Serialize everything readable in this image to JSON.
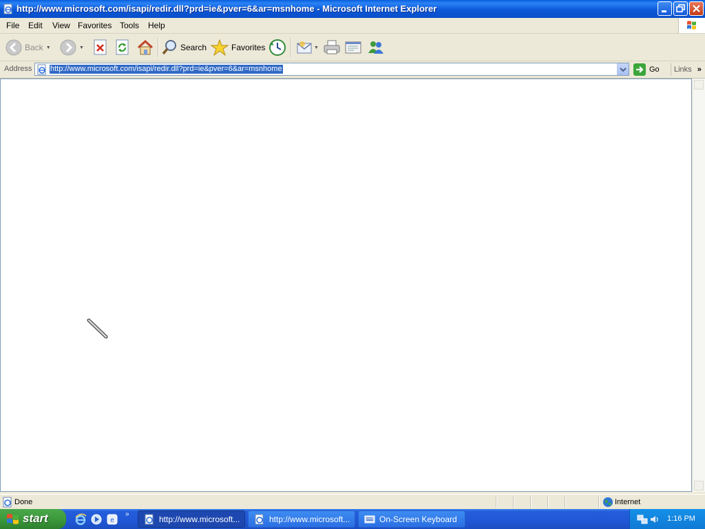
{
  "window": {
    "title": "http://www.microsoft.com/isapi/redir.dll?prd=ie&pver=6&ar=msnhome - Microsoft Internet Explorer"
  },
  "menu": {
    "items": [
      "File",
      "Edit",
      "View",
      "Favorites",
      "Tools",
      "Help"
    ]
  },
  "toolbar": {
    "back_label": "Back",
    "search_label": "Search",
    "favorites_label": "Favorites"
  },
  "address": {
    "label": "Address",
    "url": "http://www.microsoft.com/isapi/redir.dll?prd=ie&pver=6&ar=msnhome",
    "go_label": "Go",
    "links_label": "Links"
  },
  "status": {
    "text": "Done",
    "zone": "Internet"
  },
  "taskbar": {
    "start_label": "start",
    "tasks": [
      {
        "label": "http://www.microsoft..."
      },
      {
        "label": "http://www.microsoft..."
      },
      {
        "label": "On-Screen Keyboard"
      }
    ],
    "clock": "1:16 PM"
  }
}
